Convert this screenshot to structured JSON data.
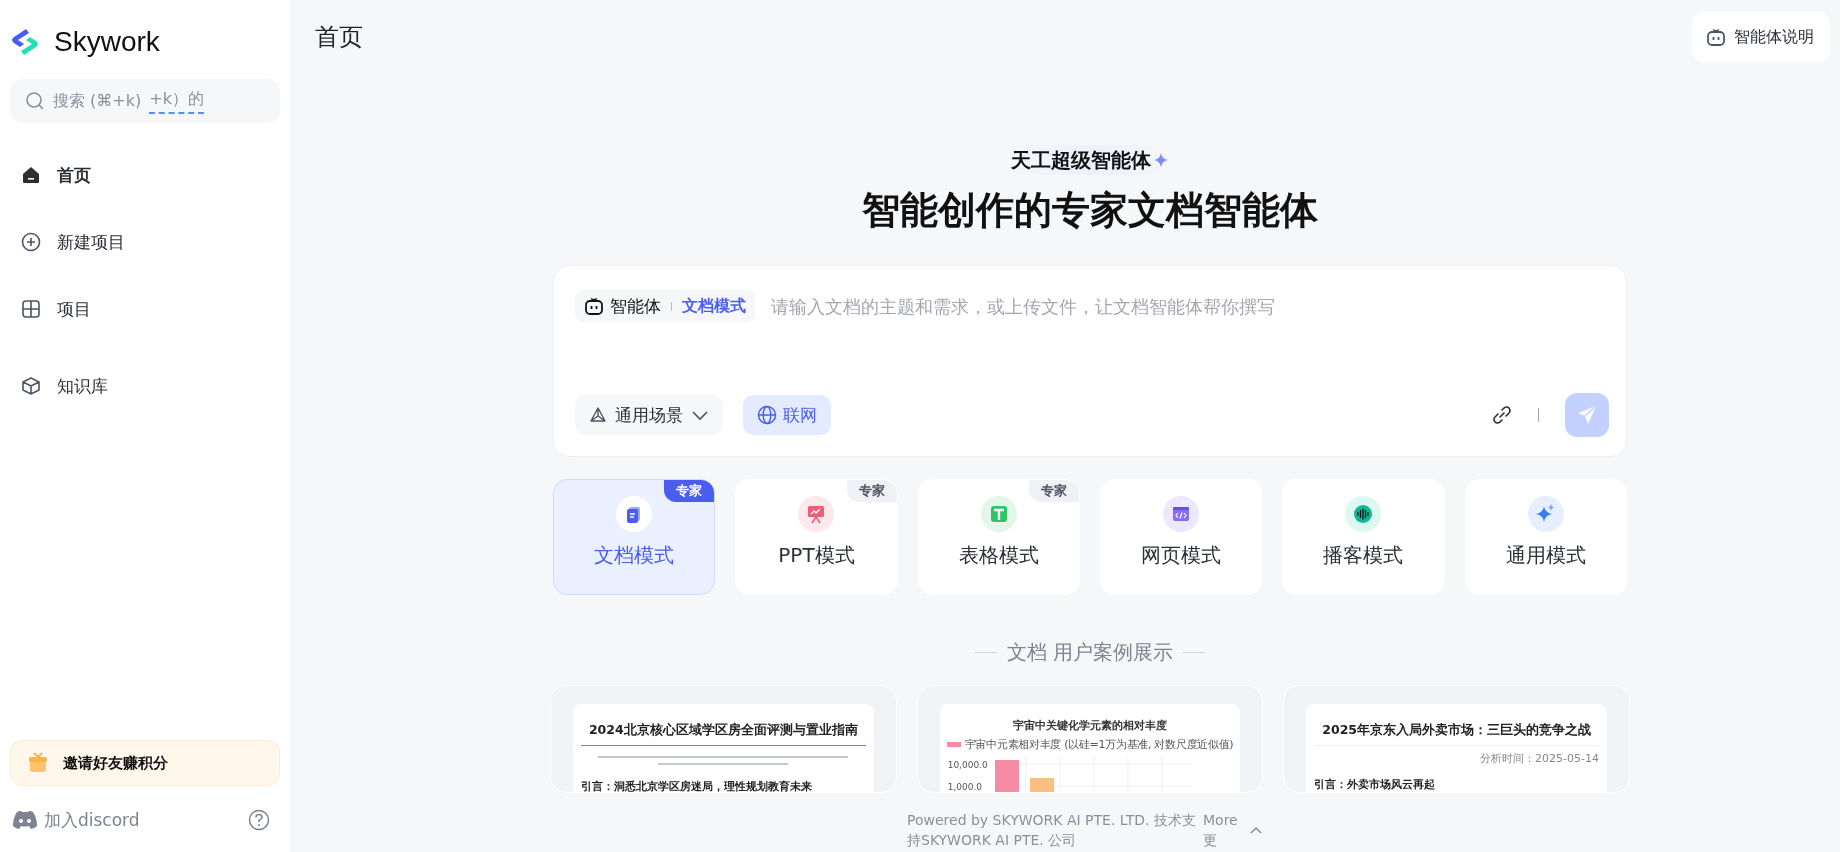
{
  "sidebar": {
    "logo_text": "Skywork",
    "search": {
      "placeholder": "搜索 (⌘+k)",
      "composition": "+k）的"
    },
    "nav": [
      {
        "label": "首页",
        "kind": "home",
        "selected": true
      },
      {
        "label": "新建项目",
        "kind": "add",
        "selected": false
      },
      {
        "label": "项目",
        "kind": "projects",
        "selected": false
      },
      {
        "label": "知识库",
        "kind": "knowledge",
        "selected": false
      }
    ],
    "invite": "邀请好友赚积分",
    "discord": "加入discord"
  },
  "header": {
    "title": "首页",
    "help_button": "智能体说明"
  },
  "hero": {
    "badge": "天工超级智能体",
    "heading": "智能创作的专家文档智能体"
  },
  "composer": {
    "agent_label": "智能体",
    "mode_label": "文档模式",
    "placeholder": "请输入文档的主题和需求，或上传文件，让文档智能体帮你撰写",
    "scene_dropdown": "通用场景",
    "web_toggle": {
      "label": "联网",
      "on": true
    },
    "send_disabled": true
  },
  "modes": [
    {
      "label": "文档模式",
      "kind": "doc",
      "selected": true,
      "tag": "专家"
    },
    {
      "label": "PPT模式",
      "kind": "ppt",
      "selected": false,
      "tag": "专家"
    },
    {
      "label": "表格模式",
      "kind": "sheet",
      "selected": false,
      "tag": "专家"
    },
    {
      "label": "网页模式",
      "kind": "web",
      "selected": false
    },
    {
      "label": "播客模式",
      "kind": "podcast",
      "selected": false
    },
    {
      "label": "通用模式",
      "kind": "general",
      "selected": false
    }
  ],
  "cases": {
    "title": "文档 用户案例展示",
    "items": [
      {
        "kind": "report",
        "title": "2024北京核心区域学区房全面评测与置业指南",
        "intro": "引言：洞悉北京学区房迷局，理性规划教育未来"
      },
      {
        "kind": "chart",
        "title": "宇宙中关键化学元素的相对丰度",
        "legend": "宇宙中元素相对丰度 (以硅=1万为基准, 对数尺度近似值)",
        "ticks": [
          "10,000.0",
          "1,000.0"
        ]
      },
      {
        "kind": "report",
        "title": "2025年京东入局外卖市场：三巨头的竞争之战",
        "date": "分析时间：2025-05-14",
        "intro": "引言：外卖市场风云再起"
      }
    ]
  },
  "footer": {
    "text": "Powered by SKYWORK AI PTE. LTD. 技术支持SKYWORK AI PTE. 公司",
    "more": "More 更"
  }
}
